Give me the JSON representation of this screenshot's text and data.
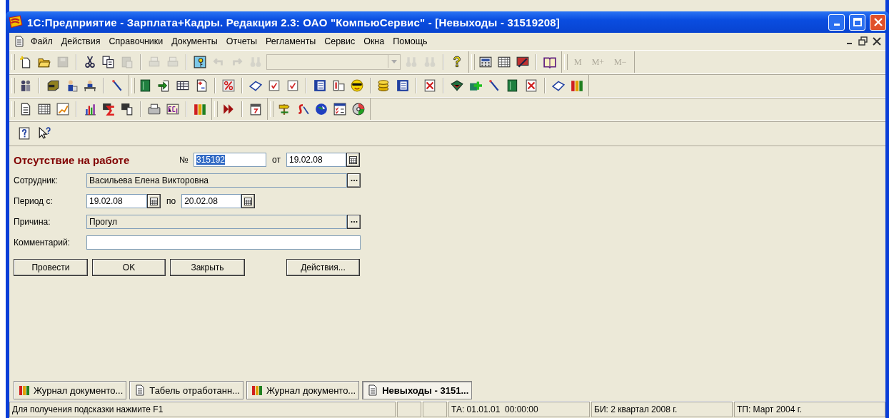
{
  "window": {
    "title": "1С:Предприятие - Зарплата+Кадры. Редакция 2.3: ОАО \"КомпьюСервис\" - [Невыходы - 31519208]"
  },
  "menu": {
    "items": [
      "Файл",
      "Действия",
      "Справочники",
      "Документы",
      "Отчеты",
      "Регламенты",
      "Сервис",
      "Окна",
      "Помощь"
    ]
  },
  "memory_buttons": [
    {
      "label": "M",
      "disabled": true
    },
    {
      "label": "M+",
      "disabled": true
    },
    {
      "label": "M−",
      "disabled": true
    }
  ],
  "form": {
    "heading": "Отсутствие на работе",
    "number_label": "№",
    "number": {
      "value": "315192",
      "selected": true
    },
    "date_label": "от",
    "date": "19.02.08",
    "employee": {
      "label": "Сотрудник:",
      "value": "Васильева Елена Викторовна"
    },
    "period": {
      "label": "Период с:",
      "from": "19.02.08",
      "to_label": "по",
      "to": "20.02.08"
    },
    "reason": {
      "label": "Причина:",
      "value": "Прогул"
    },
    "comment": {
      "label": "Комментарий:"
    },
    "buttons": [
      {
        "label": "Провести"
      },
      {
        "label": "OK"
      },
      {
        "label": "Закрыть"
      },
      {
        "label": "Действия..."
      }
    ]
  },
  "tabs": [
    {
      "label": "Журнал документо...",
      "kind": "journal",
      "selected": false
    },
    {
      "label": "Табель отработанн...",
      "kind": "document",
      "selected": false
    },
    {
      "label": "Журнал документо...",
      "kind": "journal",
      "selected": false
    },
    {
      "label": "Невыходы - 3151...",
      "kind": "document",
      "selected": true
    }
  ],
  "status_bar": {
    "hint": "Для получения подсказки нажмите F1",
    "cells": [
      "ТА: 01.01.01  00:00:00",
      "БИ: 2 квартал 2008 г.",
      "ТП: Март 2004 г."
    ]
  }
}
